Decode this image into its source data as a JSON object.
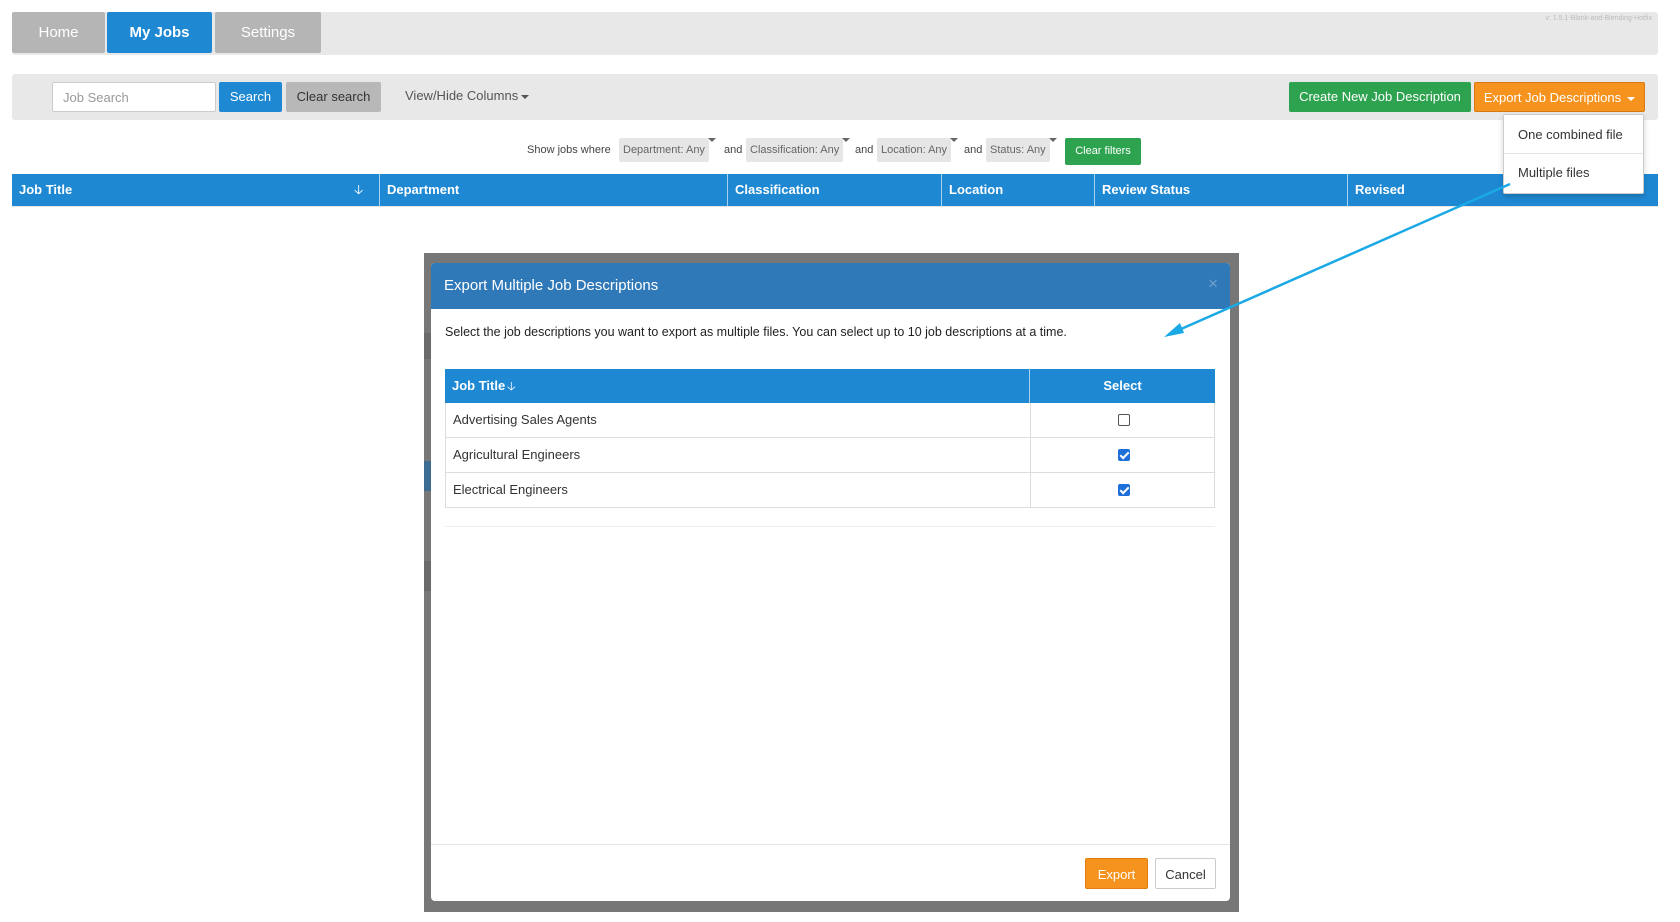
{
  "nav": {
    "tabs": [
      {
        "label": "Home"
      },
      {
        "label": "My Jobs"
      },
      {
        "label": "Settings"
      }
    ],
    "version": "v: 1.5.1-Blank-and-Blending-Hotfix"
  },
  "toolbar": {
    "search_placeholder": "Job Search",
    "search_label": "Search",
    "clear_label": "Clear search",
    "view_hide_label": "View/Hide Columns",
    "create_label": "Create New Job Description",
    "export_label": "Export Job Descriptions"
  },
  "export_menu": {
    "items": [
      {
        "label": "One combined file"
      },
      {
        "label": "Multiple files"
      }
    ]
  },
  "filters": {
    "prefix": "Show jobs where",
    "department": "Department: Any",
    "classification": "Classification: Any",
    "location": "Location: Any",
    "status": "Status: Any",
    "joiner": "and",
    "clear_label": "Clear filters"
  },
  "table": {
    "columns": [
      "Job Title",
      "Department",
      "Classification",
      "Location",
      "Review Status",
      "Revised"
    ]
  },
  "modal": {
    "title": "Export Multiple Job Descriptions",
    "close": "×",
    "description": "Select the job descriptions you want to export as multiple files. You can select up to 10 job descriptions at a time.",
    "columns": {
      "title": "Job Title",
      "select": "Select"
    },
    "rows": [
      {
        "title": "Advertising Sales Agents",
        "selected": false
      },
      {
        "title": "Agricultural Engineers",
        "selected": true
      },
      {
        "title": "Electrical Engineers",
        "selected": true
      }
    ],
    "export_label": "Export",
    "cancel_label": "Cancel"
  },
  "colors": {
    "primary": "#1e88d3",
    "modal_header": "#3079b9",
    "success": "#2ea34f",
    "warning": "#f6931e",
    "annotation_arrow": "#1ba9e6"
  },
  "icons": {
    "sort": "arrow-down-icon",
    "caret": "caret-down-icon",
    "close": "close-icon",
    "checkbox": "checkbox-icon"
  }
}
